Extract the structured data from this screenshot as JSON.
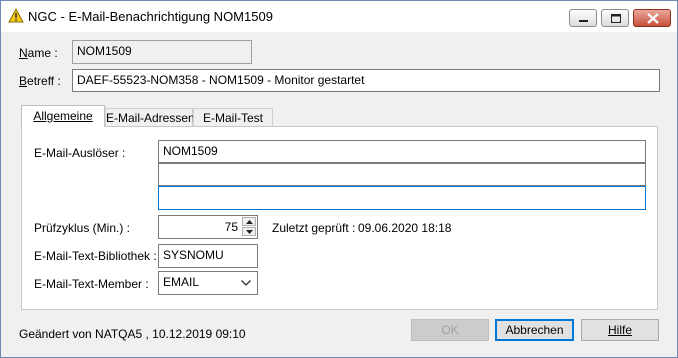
{
  "titlebar": {
    "title": "NGC - E-Mail-Benachrichtigung NOM1509",
    "icon": "warning-bell-icon",
    "controls": [
      "minimize-icon",
      "maximize-icon",
      "close-icon"
    ]
  },
  "header": {
    "name_label_prefix": "N",
    "name_label_rest": "ame :",
    "name_value": "NOM1509",
    "betreff_label_prefix": "B",
    "betreff_label_rest": "etreff :",
    "betreff_value": "DAEF-55523-NOM358 - NOM1509 - Monitor gestartet"
  },
  "tabs": [
    {
      "label": "Allgemeine",
      "active": true
    },
    {
      "label": "E-Mail-Adressen",
      "active": false
    },
    {
      "label": "E-Mail-Test",
      "active": false
    }
  ],
  "general": {
    "ausloeser_label": "E-Mail-Auslöser :",
    "ausloeser_values": [
      "NOM1509",
      "",
      ""
    ],
    "pruefzyklus_label": "Prüfzyklus (Min.) :",
    "pruefzyklus_value": "75",
    "zuletzt_label": "Zuletzt geprüft :",
    "zuletzt_value": "09.06.2020 18:18",
    "bibliothek_label": "E-Mail-Text-Bibliothek :",
    "bibliothek_value": "SYSNOMU",
    "member_label": "E-Mail-Text-Member :",
    "member_value": "EMAIL"
  },
  "footer": {
    "changed_text": "Geändert von NATQA5 , 10.12.2019 09:10",
    "ok_label": "OK",
    "cancel_label": "Abbrechen",
    "help_label": "Hilfe"
  },
  "colors": {
    "accent": "#0078d7",
    "close_button": "#c7503a"
  }
}
